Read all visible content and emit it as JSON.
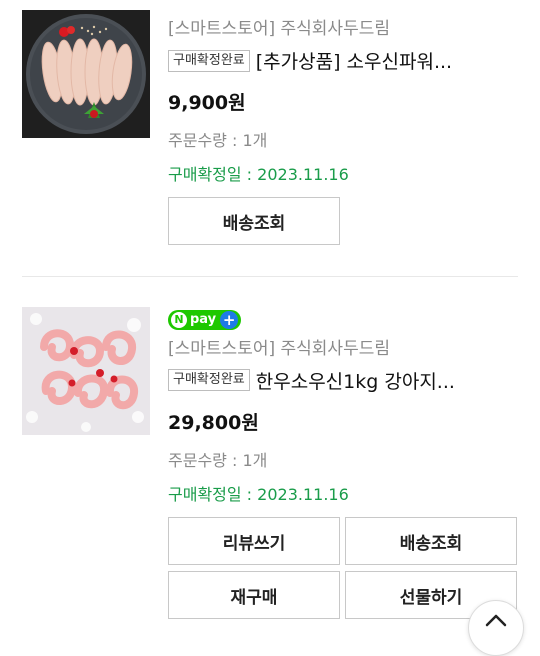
{
  "orders": [
    {
      "store": "[스마트스토어] 주식회사두드림",
      "badge": "구매확정완료",
      "product": "[추가상품] 소우신파워...",
      "price": "9,900원",
      "quantity": "주문수량 : 1개",
      "confirm_date": "구매확정일 : 2023.11.16",
      "buttons": [
        "배송조회"
      ],
      "thumbnail": "chicken-breast-plate"
    },
    {
      "npay_badge": "pay",
      "store": "[스마트스토어] 주식회사두드림",
      "badge": "구매확정완료",
      "product": "한우소우신1kg 강아지...",
      "price": "29,800원",
      "quantity": "주문수량 : 1개",
      "confirm_date": "구매확정일 : 2023.11.16",
      "buttons": [
        "리뷰쓰기",
        "배송조회",
        "재구매",
        "선물하기"
      ],
      "thumbnail": "beef-coil-chews"
    }
  ],
  "colors": {
    "confirm_green": "#1a9c4a",
    "npay_green": "#1ec800",
    "npay_blue": "#1e7be6"
  },
  "icons": {
    "scroll_top": "chevron-up-icon"
  }
}
